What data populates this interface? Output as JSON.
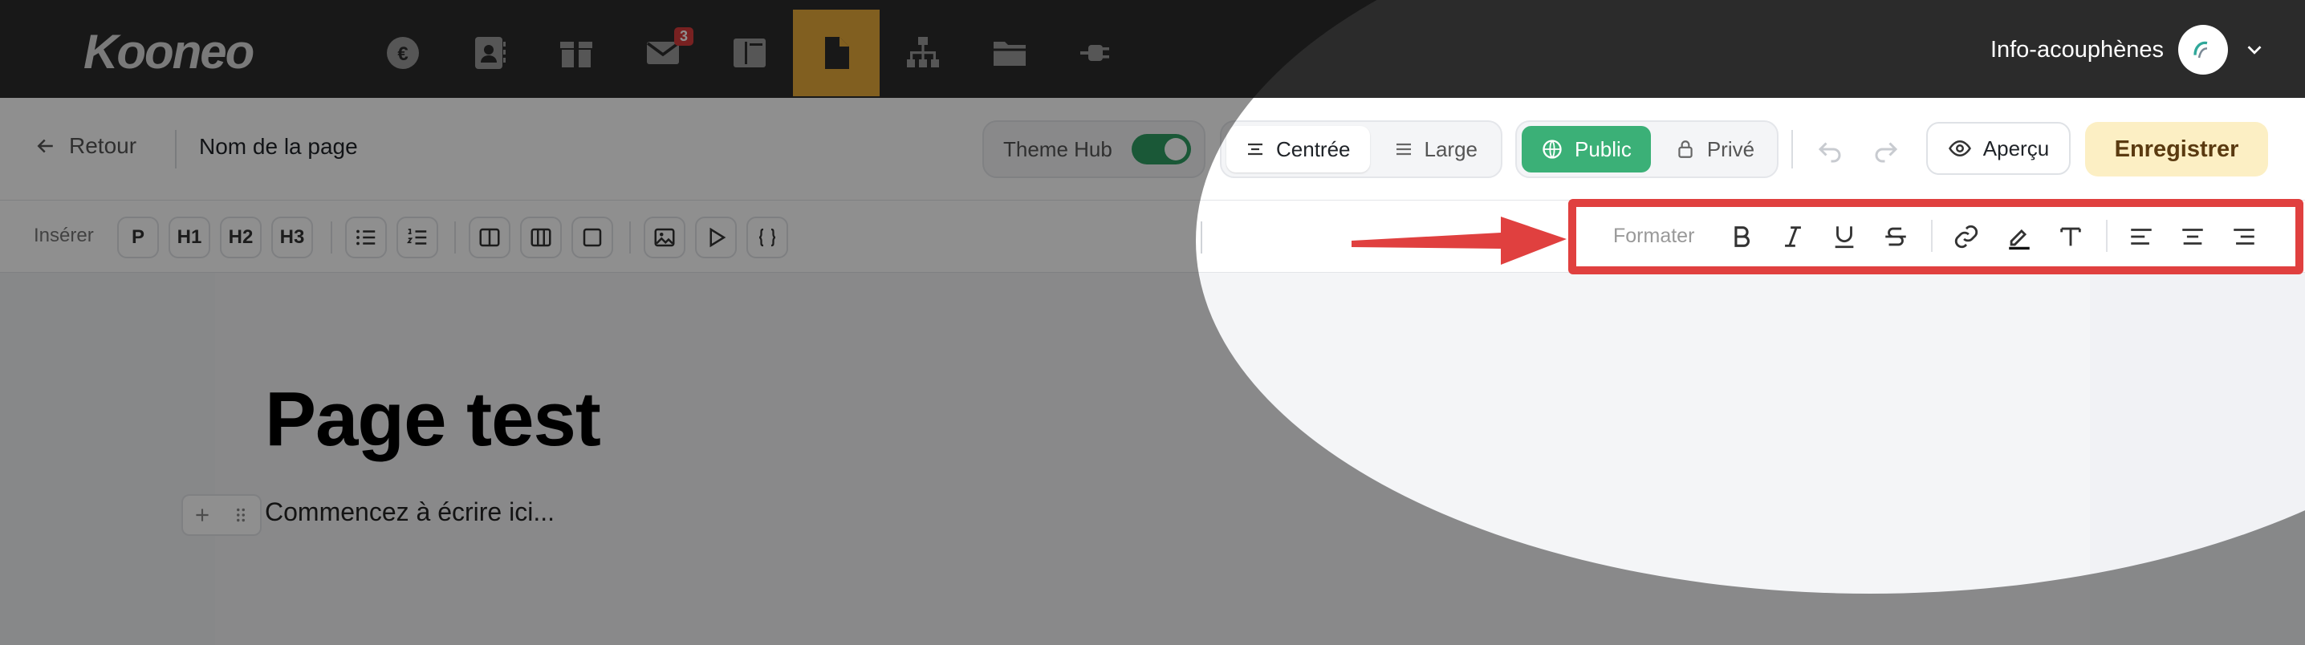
{
  "nav": {
    "logo": "Kooneo",
    "icons": [
      {
        "name": "euro-icon"
      },
      {
        "name": "contacts-icon"
      },
      {
        "name": "box-icon"
      },
      {
        "name": "mail-icon",
        "badge": "3"
      },
      {
        "name": "layout-icon"
      },
      {
        "name": "page-icon",
        "active": true
      },
      {
        "name": "sitemap-icon"
      },
      {
        "name": "folder-icon"
      },
      {
        "name": "plug-icon"
      }
    ],
    "account_name": "Info-acouphènes"
  },
  "header": {
    "back_label": "Retour",
    "page_name": "Nom de la page",
    "theme_hub_label": "Theme Hub",
    "theme_hub_on": true,
    "layout_options": [
      "Centrée",
      "Large"
    ],
    "layout_selected": "Centrée",
    "visibility_options": [
      "Public",
      "Privé"
    ],
    "visibility_selected": "Public",
    "preview_label": "Aperçu",
    "save_label": "Enregistrer"
  },
  "editor_toolbar": {
    "insert_label": "Insérer",
    "insert_buttons": [
      "P",
      "H1",
      "H2",
      "H3"
    ],
    "format_label": "Formater",
    "format_icons": [
      "bold-icon",
      "italic-icon",
      "underline-icon",
      "strikethrough-icon",
      "link-icon",
      "highlight-icon",
      "text-type-icon",
      "align-left-icon",
      "align-center-icon",
      "align-right-icon"
    ]
  },
  "content": {
    "title": "Page test",
    "placeholder": "Commencez à écrire ici..."
  },
  "colors": {
    "accent": "#e7a93a",
    "green": "#3bb077",
    "save_bg": "#fcefc4",
    "annotation": "#e0403f"
  }
}
